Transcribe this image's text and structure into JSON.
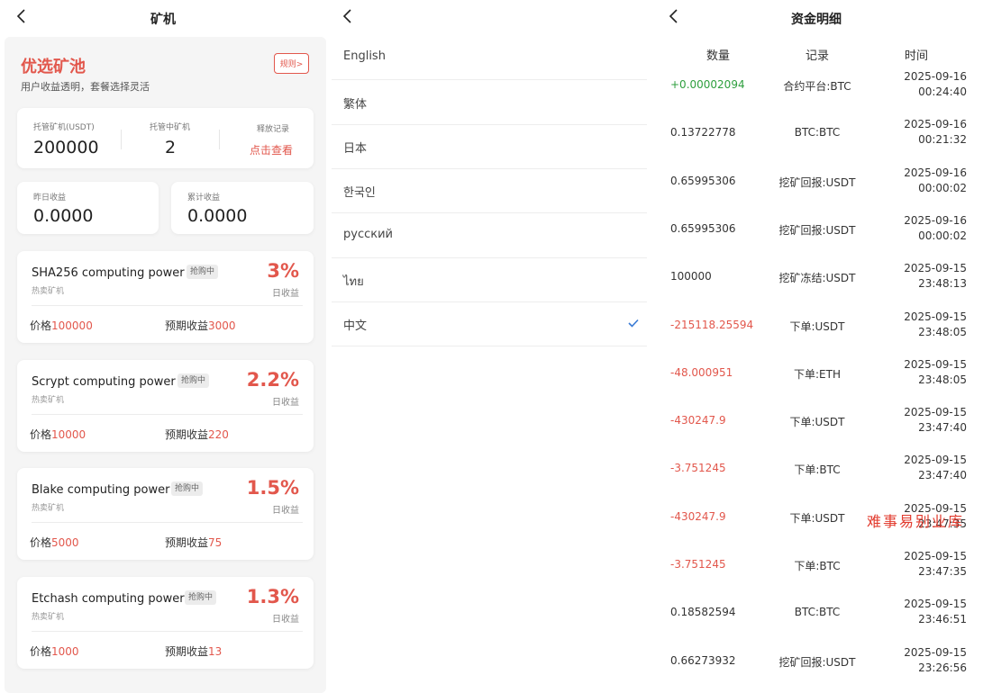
{
  "mining": {
    "title": "矿机",
    "hero_title": "优选矿池",
    "hero_subtitle": "用户收益透明，套餐选择灵活",
    "rules_label": "规则>",
    "stats": {
      "hosted_label": "托管矿机(USDT)",
      "hosted_value": "200000",
      "running_label": "托管中矿机",
      "running_value": "2",
      "release_label": "释放记录",
      "release_link": "点击查看"
    },
    "earnings": {
      "yesterday_label": "昨日收益",
      "yesterday_value": "0.0000",
      "total_label": "累计收益",
      "total_value": "0.0000"
    },
    "price_label": "价格",
    "expected_label": "预期收益",
    "daily_label": "日收益",
    "hot_label": "热卖矿机",
    "badge_label": "抢购中",
    "miners": [
      {
        "name": "SHA256 computing power",
        "rate": "3%",
        "price": "100000",
        "expected": "3000"
      },
      {
        "name": "Scrypt computing power",
        "rate": "2.2%",
        "price": "10000",
        "expected": "220"
      },
      {
        "name": "Blake computing power",
        "rate": "1.5%",
        "price": "5000",
        "expected": "75"
      },
      {
        "name": "Etchash computing power",
        "rate": "1.3%",
        "price": "1000",
        "expected": "13"
      }
    ]
  },
  "language": {
    "options": [
      "English",
      "繁体",
      "日本",
      "한국인",
      "русский",
      "ไทย",
      "中文"
    ],
    "selected": "中文"
  },
  "funds": {
    "title": "资金明细",
    "col_amount": "数量",
    "col_record": "记录",
    "col_time": "时间",
    "rows": [
      {
        "amount": "+0.00002094",
        "record": "合约平台:BTC",
        "date": "2025-09-16",
        "time": "00:24:40",
        "tone": "pos"
      },
      {
        "amount": "0.13722778",
        "record": "BTC:BTC",
        "date": "2025-09-16",
        "time": "00:21:32",
        "tone": "neu"
      },
      {
        "amount": "0.65995306",
        "record": "挖矿回报:USDT",
        "date": "2025-09-16",
        "time": "00:00:02",
        "tone": "neu"
      },
      {
        "amount": "0.65995306",
        "record": "挖矿回报:USDT",
        "date": "2025-09-16",
        "time": "00:00:02",
        "tone": "neu"
      },
      {
        "amount": "100000",
        "record": "挖矿冻结:USDT",
        "date": "2025-09-15",
        "time": "23:48:13",
        "tone": "neu"
      },
      {
        "amount": "-215118.25594",
        "record": "下单:USDT",
        "date": "2025-09-15",
        "time": "23:48:05",
        "tone": "neg"
      },
      {
        "amount": "-48.000951",
        "record": "下单:ETH",
        "date": "2025-09-15",
        "time": "23:48:05",
        "tone": "neg"
      },
      {
        "amount": "-430247.9",
        "record": "下单:USDT",
        "date": "2025-09-15",
        "time": "23:47:40",
        "tone": "neg"
      },
      {
        "amount": "-3.751245",
        "record": "下单:BTC",
        "date": "2025-09-15",
        "time": "23:47:40",
        "tone": "neg"
      },
      {
        "amount": "-430247.9",
        "record": "下单:USDT",
        "date": "2025-09-15",
        "time": "23:47:35",
        "tone": "neg"
      },
      {
        "amount": "-3.751245",
        "record": "下单:BTC",
        "date": "2025-09-15",
        "time": "23:47:35",
        "tone": "neg"
      },
      {
        "amount": "0.18582594",
        "record": "BTC:BTC",
        "date": "2025-09-15",
        "time": "23:46:51",
        "tone": "neu"
      },
      {
        "amount": "0.66273932",
        "record": "挖矿回报:USDT",
        "date": "2025-09-15",
        "time": "23:26:56",
        "tone": "neu"
      }
    ],
    "watermark": "难事易别业库"
  },
  "colors": {
    "accent": "#e2574c",
    "positive": "#2e9f3e",
    "check": "#3a7bd5"
  }
}
